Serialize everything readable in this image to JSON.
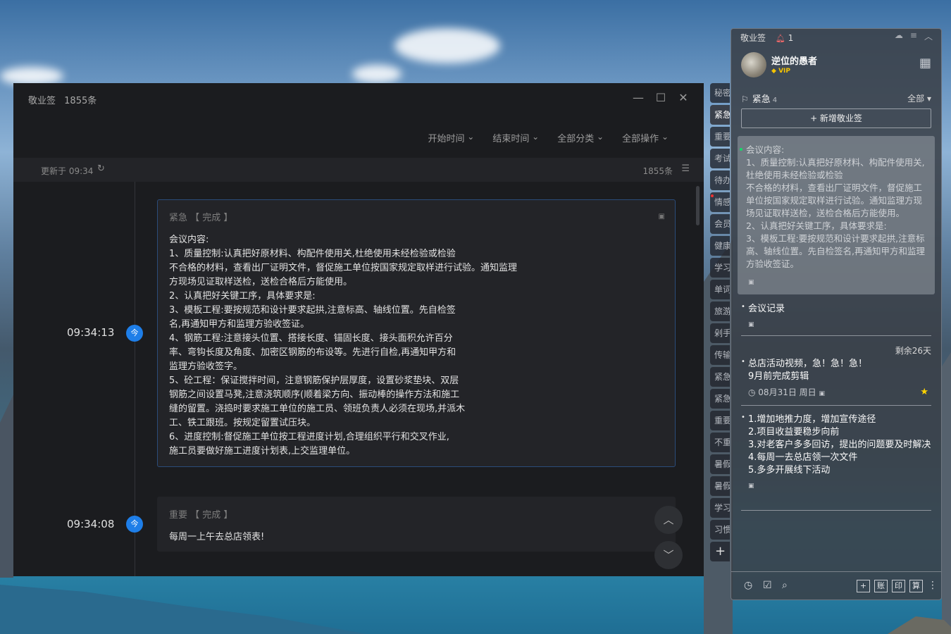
{
  "main_window": {
    "app_name": "敬业签",
    "total_label": "1855条",
    "filters": [
      "开始时间",
      "结束时间",
      "全部分类",
      "全部操作"
    ],
    "updated_at": "更新于 09:34",
    "count": "1855条"
  },
  "timeline": [
    {
      "time": "09:34:13",
      "today_badge": "今",
      "meta": "紧急 【 完成 】",
      "content": "会议内容:\n1、质量控制:认真把好原材料、构配件使用关,杜绝使用未经检验或检验\n不合格的材料，查看出厂证明文件，督促施工单位按国家规定取样进行试验。通知监理\n方现场见证取样送检，送检合格后方能使用。\n2、认真把好关键工序，具体要求是:\n3、模板工程:要按规范和设计要求起拱,注意标高、轴线位置。先自检签\n名,再通知甲方和监理方验收签证。\n4、钢筋工程:注意接头位置、搭接长度、锚固长度、接头面积允许百分\n率、弯钩长度及角度、加密区钢筋的布设等。先进行自检,再通知甲方和\n监理方验收签字。\n5、砼工程：保证搅拌时间，注意钢筋保护层厚度，设置砂浆垫块、双层\n钢筋之间设置马凳,注意浇筑顺序(顺着梁方向、振动棒的操作方法和施工\n缝的留置。浇捣时要求施工单位的施工员、领班负责人必须在现场,并派木\n工、铁工跟班。按规定留置试压块。\n6、进度控制:督促施工单位按工程进度计划,合理组织平行和交叉作业,\n施工员要做好施工进度计划表,上交监理单位。"
    },
    {
      "time": "09:34:08",
      "today_badge": "今",
      "meta": "重要 【 完成 】",
      "content": "每周一上午去总店领表!"
    }
  ],
  "side_tabs": [
    "秘密",
    "紧急",
    "重要",
    "考试",
    "待办",
    "情感",
    "会员",
    "健康",
    "学习",
    "单词",
    "旅游",
    "剁手",
    "传输",
    "紧急",
    "紧急",
    "重要",
    "不重",
    "暑假",
    "暑假",
    "学习",
    "习惯"
  ],
  "sticky": {
    "app_name": "敬业签",
    "notif_count": "1",
    "username": "逆位的愚者",
    "vip": "VIP",
    "category": "紧急",
    "category_count": "4",
    "filter_all": "全部",
    "new_button": "+ 新增敬业签",
    "notes": [
      {
        "text": "会议内容:\n1、质量控制:认真把好原材料、构配件使用关,杜绝使用未经检验或检验\n不合格的材料，查看出厂证明文件，督促施工单位按国家规定取样进行试验。通知监理方现场见证取样送检，送检合格后方能使用。\n2、认真把好关键工序，具体要求是:\n3、模板工程:要按规范和设计要求起拱,注意标高、轴线位置。先自检签名,再通知甲方和监理方验收签证。"
      },
      {
        "text": "会议记录"
      },
      {
        "remaining": "剩余26天",
        "text": "总店活动视频，急！急！急！\n9月前完成剪辑",
        "date": "08月31日 周日"
      },
      {
        "text": "1.增加地推力度，增加宣传途径\n2.项目收益要稳步向前\n3.对老客户多多回访，提出的问题要及时解决\n4.每周一去总店领一次文件\n5.多多开展线下活动"
      }
    ],
    "bottom_buttons": [
      "账",
      "印",
      "算"
    ]
  }
}
